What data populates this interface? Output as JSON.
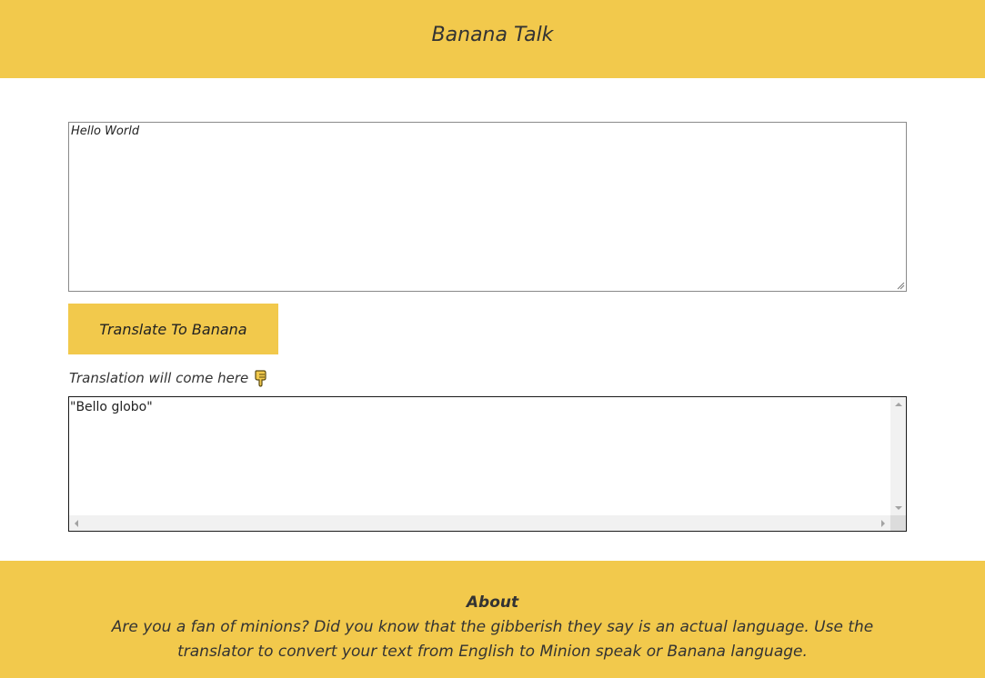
{
  "header": {
    "title": "Banana Talk"
  },
  "input": {
    "value": "Hello World"
  },
  "translate_button": {
    "label": "Translate To Banana"
  },
  "output": {
    "label": "Translation will come here",
    "label_icon": "hand-pointing-down-icon",
    "value": "\"Bello globo\""
  },
  "footer": {
    "heading": "About",
    "text": "Are you a fan of minions? Did you know that the gibberish they say is an actual language. Use the translator to convert your text from English to Minion speak or Banana language."
  },
  "colors": {
    "accent": "#f2c94c",
    "text": "#333333",
    "background": "#ffffff"
  }
}
